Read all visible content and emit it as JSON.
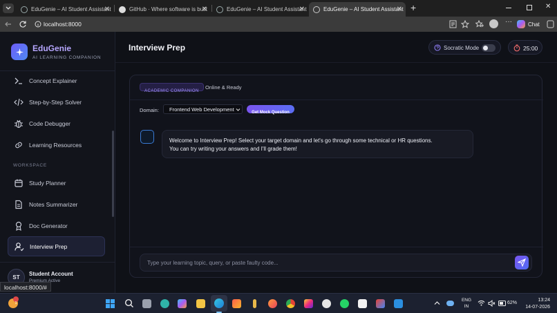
{
  "browser": {
    "tabs": [
      {
        "title": "EduGenie – AI Student Assistant"
      },
      {
        "title": "GitHub · Where software is built"
      },
      {
        "title": "EduGenie – AI Student Assistant"
      },
      {
        "title": "EduGenie – AI Student Assistant"
      }
    ],
    "url": "localhost:8000",
    "chat_label": "Chat",
    "status_url": "localhost:8000/#"
  },
  "app": {
    "name": "EduGenie",
    "tagline": "AI LEARNING COMPANION",
    "nav_items": [
      {
        "label": "Concept Explainer",
        "icon": "terminal-icon"
      },
      {
        "label": "Step-by-Step Solver",
        "icon": "code-icon"
      },
      {
        "label": "Code Debugger",
        "icon": "bug-icon"
      },
      {
        "label": "Learning Resources",
        "icon": "link-icon"
      }
    ],
    "workspace_heading": "WORKSPACE",
    "workspace_items": [
      {
        "label": "Study Planner",
        "icon": "calendar-icon"
      },
      {
        "label": "Notes Summarizer",
        "icon": "document-icon"
      },
      {
        "label": "Doc Generator",
        "icon": "award-icon"
      },
      {
        "label": "Interview Prep",
        "icon": "user-check-icon",
        "active": true
      }
    ],
    "account": {
      "initials": "ST",
      "name": "Student Account",
      "plan": "Premium Active"
    }
  },
  "header": {
    "title": "Interview Prep",
    "socratic_label": "Socratic Mode",
    "socratic_on": false,
    "timer": "25:00"
  },
  "chat": {
    "badge": "ACADEMIC COMPANION",
    "status": "Online & Ready",
    "domain_label": "Domain:",
    "domain_selected": "Frontend Web Development",
    "mock_button": "Get Mock Question",
    "bot_message_line1": "Welcome to Interview Prep! Select your target domain and let's go through some technical or HR questions.",
    "bot_message_line2": "You can try writing your answers and I'll grade them!",
    "input_placeholder": "Type your learning topic, query, or paste faulty code..."
  },
  "taskbar": {
    "lang_line1": "ENG",
    "lang_line2": "IN",
    "battery": "62%",
    "time": "13:24",
    "date": "14-07-2026",
    "notification_count": "1"
  },
  "colors": {
    "accent_purple": "#7c5cf0",
    "accent_blue": "#4f6cf5",
    "sidebar_bg": "#12141b",
    "main_bg": "#0f1117"
  }
}
